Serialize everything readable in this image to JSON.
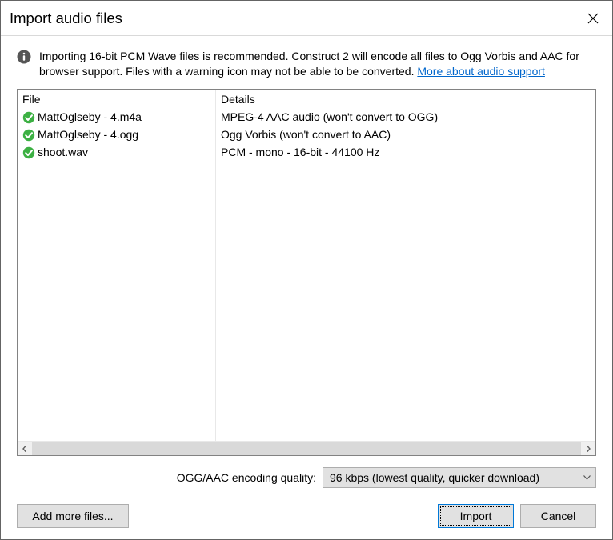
{
  "title": "Import audio files",
  "info": {
    "text_part1": "Importing 16-bit PCM Wave files is recommended.  Construct 2 will encode all files to Ogg Vorbis and AAC for browser support.  Files with a warning icon may not be able to be converted.  ",
    "link_text": "More about audio support"
  },
  "columns": {
    "file": "File",
    "details": "Details"
  },
  "files": [
    {
      "status": "ok",
      "name": "MattOglseby - 4.m4a",
      "details": "MPEG-4 AAC audio (won't convert to OGG)"
    },
    {
      "status": "ok",
      "name": "MattOglseby - 4.ogg",
      "details": "Ogg Vorbis (won't convert to AAC)"
    },
    {
      "status": "ok",
      "name": "shoot.wav",
      "details": "PCM - mono - 16-bit - 44100 Hz"
    }
  ],
  "quality": {
    "label": "OGG/AAC encoding quality:",
    "selected": "96 kbps (lowest quality, quicker download)"
  },
  "buttons": {
    "add": "Add more files...",
    "import": "Import",
    "cancel": "Cancel"
  }
}
